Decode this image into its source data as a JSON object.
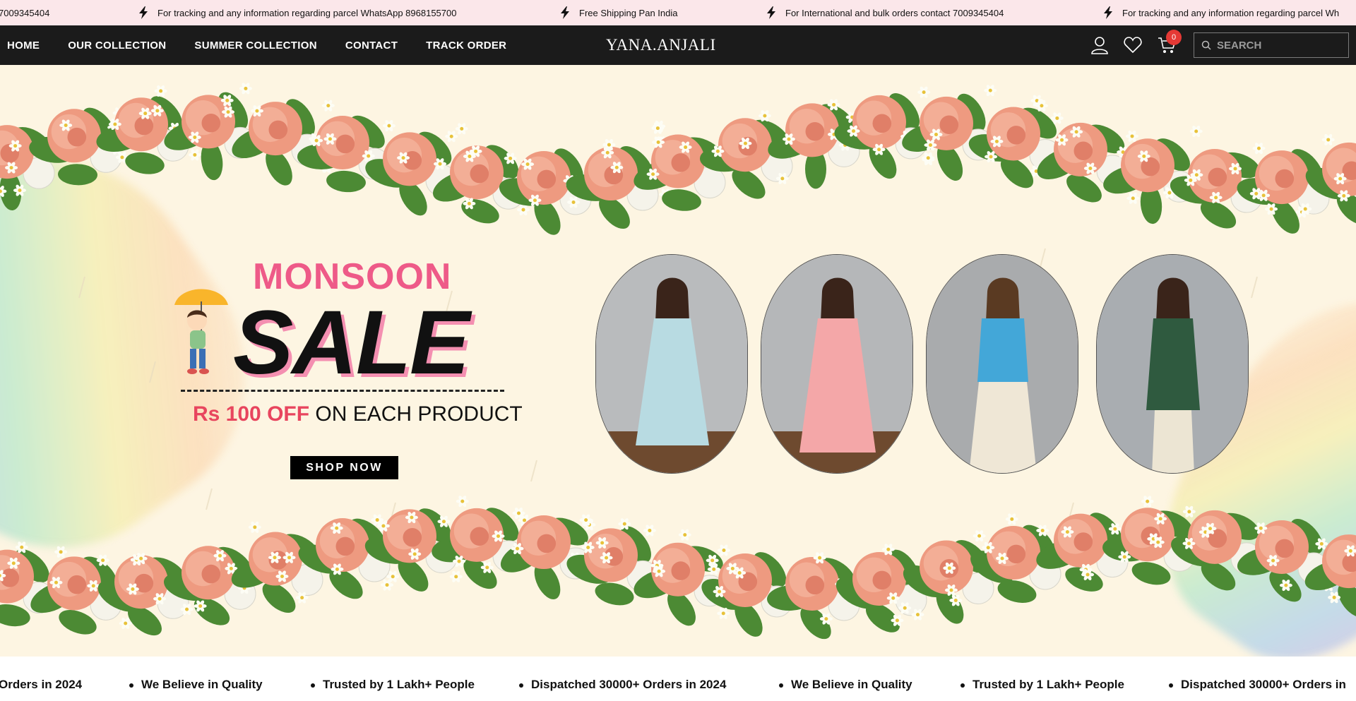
{
  "announcement": {
    "messages": [
      "7009345404",
      "For tracking and any information regarding parcel WhatsApp 8968155700",
      "Free Shipping Pan India",
      "For International and bulk orders contact 7009345404",
      "For tracking and any information regarding parcel Wh"
    ]
  },
  "nav": {
    "links": [
      "HOME",
      "OUR COLLECTION",
      "SUMMER COLLECTION",
      "CONTACT",
      "TRACK ORDER"
    ],
    "logo": "YANA.ANJALI",
    "cart_count": "0",
    "search_placeholder": "SEARCH",
    "icons": [
      "user-icon",
      "heart-icon",
      "cart-icon",
      "search-icon"
    ]
  },
  "hero": {
    "headline_top": "MONSOON",
    "headline_main": "SALE",
    "offer_highlight": "Rs 100 OFF",
    "offer_rest": " ON EACH PRODUCT",
    "cta": "SHOP NOW",
    "models": [
      "model-light-blue-dress",
      "model-pink-floral-dress",
      "model-blue-top-printed-pants",
      "model-green-kurta-set"
    ]
  },
  "ticker": {
    "items": [
      "Orders in 2024",
      "We Believe in Quality",
      "Trusted by 1 Lakh+ People",
      "Dispatched 30000+ Orders in 2024",
      "We Believe in Quality",
      "Trusted by 1 Lakh+ People",
      "Dispatched 30000+ Orders in"
    ]
  },
  "colors": {
    "announce_bg": "#fbe7ea",
    "nav_bg": "#1b1b1b",
    "hero_bg": "#fdf5e2",
    "accent_pink": "#ee5a88",
    "offer_red": "#e8455e",
    "badge_red": "#e53935"
  }
}
